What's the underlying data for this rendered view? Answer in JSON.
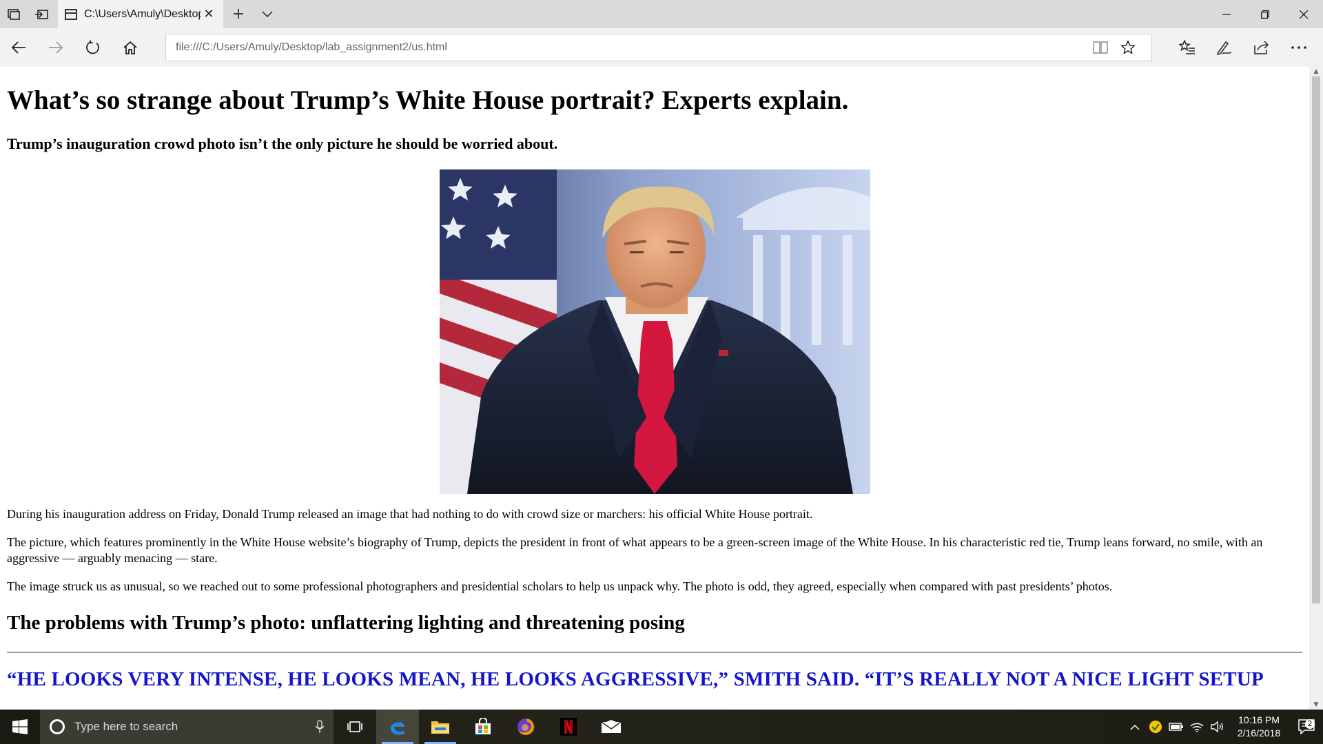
{
  "browser": {
    "tab_title": "C:\\Users\\Amuly\\Desktop",
    "tab_close": "✕",
    "new_tab": "+",
    "address": "file:///C:/Users/Amuly/Desktop/lab_assignment2/us.html"
  },
  "article": {
    "title": "What’s so strange about Trump’s White House portrait? Experts explain.",
    "subtitle": "Trump’s inauguration crowd photo isn’t the only picture he should be worried about.",
    "paragraphs": [
      "During his inauguration address on Friday, Donald Trump released an image that had nothing to do with crowd size or marchers: his official White House portrait.",
      "The picture, which features prominently in the White House website’s biography of Trump, depicts the president in front of what appears to be a green-screen image of the White House. In his characteristic red tie, Trump leans forward, no smile, with an aggressive — arguably menacing — stare.",
      "The image struck us as unusual, so we reached out to some professional photographers and presidential scholars to help us unpack why. The photo is odd, they agreed, especially when compared with past presidents’ photos."
    ],
    "section_heading": "The problems with Trump’s photo: unflattering lighting and threatening posing",
    "pull_quote": "“HE LOOKS VERY INTENSE, HE LOOKS MEAN, HE LOOKS AGGRESSIVE,” SMITH SAID. “IT’S REALLY NOT A NICE LIGHT SETUP",
    "quote_color": "#1515cc"
  },
  "taskbar": {
    "search_placeholder": "Type here to search",
    "time": "10:16 PM",
    "date": "2/16/2018",
    "notification_count": "2"
  },
  "icons": {
    "tab_strip": [
      "tab-preview-icon",
      "set-aside-tabs-icon",
      "page-icon",
      "tab-list-chevron-icon"
    ],
    "nav": [
      "back-arrow-icon",
      "forward-arrow-icon",
      "refresh-icon",
      "home-icon"
    ],
    "address": [
      "reading-view-icon",
      "favorite-star-icon"
    ],
    "tools": [
      "favorites-hub-icon",
      "web-note-icon",
      "share-icon",
      "more-icon"
    ],
    "taskbar": [
      "windows-start-icon",
      "cortana-icon",
      "microphone-icon",
      "task-view-icon",
      "edge-icon",
      "file-explorer-icon",
      "store-icon",
      "firefox-icon",
      "netflix-icon",
      "mail-icon"
    ],
    "tray": [
      "chevron-up-icon",
      "security-icon",
      "battery-icon",
      "wifi-icon",
      "volume-icon",
      "action-center-icon"
    ]
  }
}
